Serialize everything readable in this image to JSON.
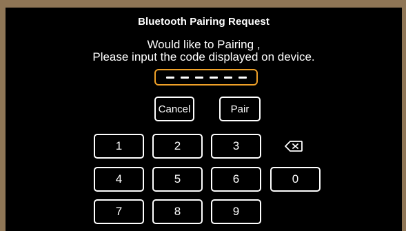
{
  "dialog": {
    "title": "Bluetooth Pairing Request",
    "message_line1": "Would like to Pairing ,",
    "message_line2": "Please input the code displayed on device."
  },
  "code_input": {
    "slots": 6,
    "value": ""
  },
  "buttons": {
    "cancel": "Cancel",
    "pair": "Pair"
  },
  "keypad": {
    "k1": "1",
    "k2": "2",
    "k3": "3",
    "k4": "4",
    "k5": "5",
    "k6": "6",
    "k0": "0",
    "k7": "7",
    "k8": "8",
    "k9": "9",
    "backspace_icon": "backspace-icon"
  },
  "colors": {
    "frame": "#8f7656",
    "dialog_bg": "#000000",
    "accent": "#f0a128",
    "text": "#ffffff"
  }
}
